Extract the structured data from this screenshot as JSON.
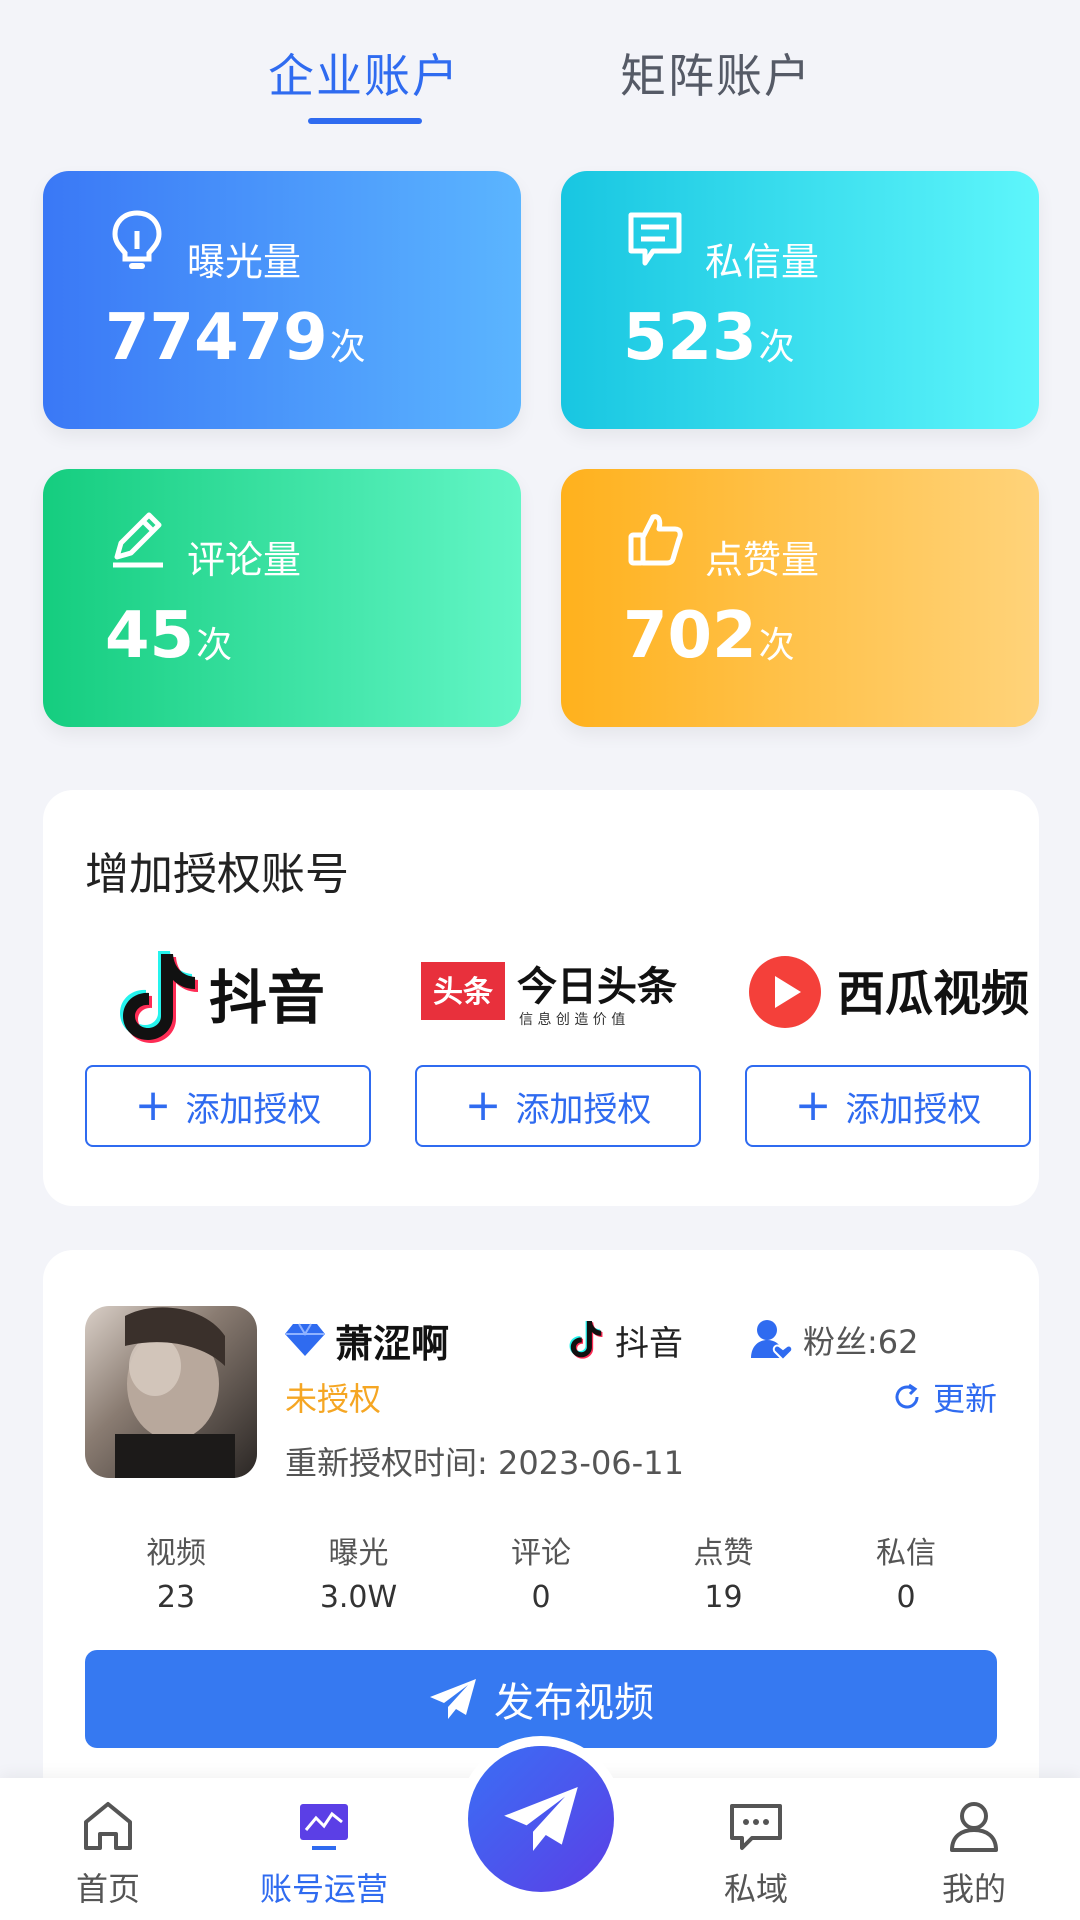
{
  "tabs": {
    "active": "企业账户",
    "inactive": "矩阵账户"
  },
  "stats": [
    {
      "label": "曝光量",
      "value": "77479",
      "unit": "次",
      "icon": "lightbulb-icon",
      "color": "#3a78f6"
    },
    {
      "label": "私信量",
      "value": "523",
      "unit": "次",
      "icon": "message-icon",
      "color": "#18c6e1"
    },
    {
      "label": "评论量",
      "value": "45",
      "unit": "次",
      "icon": "pen-icon",
      "color": "#15cd7f"
    },
    {
      "label": "点赞量",
      "value": "702",
      "unit": "次",
      "icon": "thumb-up-icon",
      "color": "#ffb11d"
    }
  ],
  "auth": {
    "title": "增加授权账号",
    "platforms": [
      {
        "name": "抖音",
        "button": "添加授权"
      },
      {
        "name": "今日头条",
        "badge": "头条",
        "slogan": "信 息 创 造 价 值",
        "button": "添加授权"
      },
      {
        "name": "西瓜视频",
        "button": "添加授权"
      }
    ]
  },
  "account": {
    "name": "萧涩啊",
    "platform": "抖音",
    "fans": "粉丝:62",
    "status": "未授权",
    "refresh": "更新",
    "reauth_time": "重新授权时间:  2023-06-11",
    "stats": [
      {
        "label": "视频",
        "value": "23"
      },
      {
        "label": "曝光",
        "value": "3.0W"
      },
      {
        "label": "评论",
        "value": "0"
      },
      {
        "label": "点赞",
        "value": "19"
      },
      {
        "label": "私信",
        "value": "0"
      }
    ],
    "publish": "发布视频"
  },
  "nav": {
    "items": [
      {
        "label": "首页"
      },
      {
        "label": "账号运营"
      },
      {
        "label": "私域"
      },
      {
        "label": "我的"
      }
    ]
  },
  "colors": {
    "accent": "#2f6bf0",
    "warning": "#f5a623"
  }
}
